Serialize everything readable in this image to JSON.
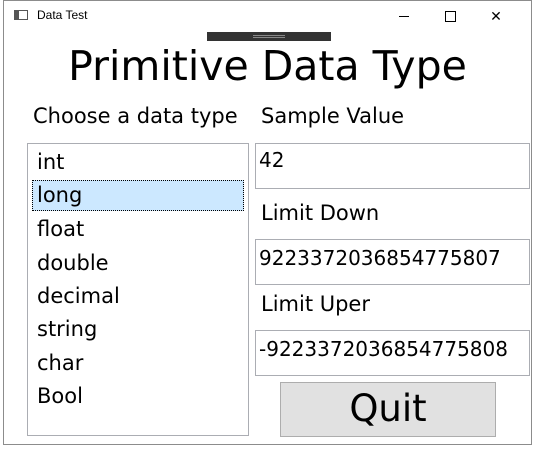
{
  "window": {
    "title": "Data Test",
    "close_glyph": "✕"
  },
  "heading": "Primitive Data Type",
  "choose_label": "Choose a data type",
  "data_types": [
    "int",
    "long",
    "float",
    "double",
    "decimal",
    "string",
    "char",
    "Bool"
  ],
  "selected_type": "long",
  "sample": {
    "label": "Sample Value",
    "value": "42"
  },
  "limit_down": {
    "label": "Limit Down",
    "value": "9223372036854775807"
  },
  "limit_upper": {
    "label": "Limit Uper",
    "value": "-9223372036854775808"
  },
  "quit_label": "Quit",
  "colors": {
    "selection": "#cce8ff",
    "button_bg": "#e1e1e1",
    "border": "#abadb3"
  }
}
